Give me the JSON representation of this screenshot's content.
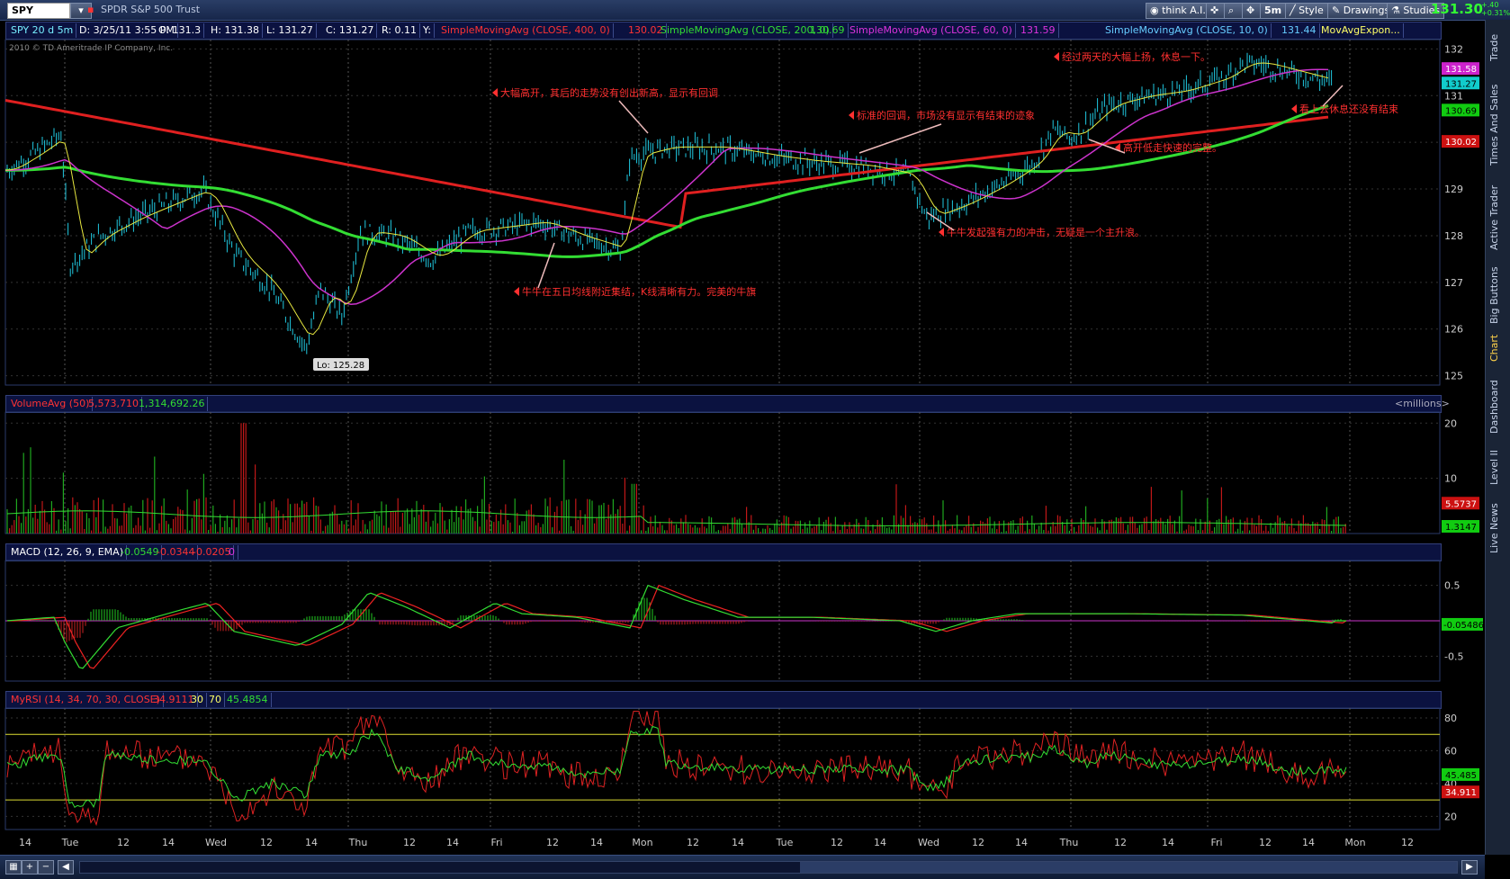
{
  "toolbar": {
    "symbol": "SPY",
    "symbol_desc": "SPDR S&P 500 Trust",
    "think_ai": "think A.I.",
    "interval": "5m",
    "style": "Style",
    "drawings": "Drawings",
    "studies": "Studies",
    "last_price": "131.30",
    "change_up": "+.40",
    "change_pct": "+0.31%"
  },
  "side_tabs": [
    "Trade",
    "Times And Sales",
    "Active Trader",
    "Big Buttons",
    "Chart",
    "Dashboard",
    "Level II",
    "Live News"
  ],
  "price_pane": {
    "header": [
      "SPY 20 d 5m",
      "D: 3/25/11 3:55 PM",
      "O: 131.3",
      "H: 131.38",
      "L: 131.27",
      "C: 131.27",
      "R: 0.11",
      "Y:",
      "SimpleMovingAvg (CLOSE, 400, 0)",
      "130.02",
      "SimpleMovingAvg (CLOSE, 200, 0)",
      "130.69",
      "SimpleMovingAvg (CLOSE, 60, 0)",
      "131.59"
    ],
    "header_right": [
      "SimpleMovingAvg (CLOSE, 10, 0)",
      "131.44",
      "MovAvgExpon..."
    ],
    "copyright": "2010 © TD Ameritrade IP Company, Inc.",
    "y_ticks": [
      "132",
      "131",
      "130",
      "129",
      "128",
      "127",
      "126",
      "125"
    ],
    "price_labels": [
      "131.58",
      "131.27",
      "130.69",
      "130.02"
    ],
    "low_label": "Lo: 125.28",
    "annotations": [
      "大幅高开，其后的走势没有创出新高，显示有回调",
      "标准的回调，市场没有显示有结束的迹象",
      "牛牛在五日均线附近集结，K线清晰有力。完美的牛旗",
      "牛牛发起强有力的冲击，无疑是一个主升浪。",
      "经过两天的大幅上扬，休息一下。",
      "高开低走快速的完整。",
      "看上去休息还没有结束"
    ]
  },
  "volume_pane": {
    "header": [
      "VolumeAvg (50)",
      "5,573,710",
      "1,314,692.26"
    ],
    "unit": "<millions>",
    "y_ticks": [
      "20",
      "10"
    ],
    "labels": [
      "5.5737",
      "1.3147"
    ]
  },
  "macd_pane": {
    "header": [
      "MACD (12, 26, 9, EMA)",
      "-0.0549",
      "-0.0344",
      "-0.0205",
      "0"
    ],
    "y_ticks": [
      "0.5",
      "-0.5"
    ],
    "label": "-0.05486"
  },
  "rsi_pane": {
    "header": [
      "MyRSI (14, 34, 70, 30, CLOSE)",
      "34.9111",
      "30",
      "70",
      "45.4854"
    ],
    "y_ticks": [
      "80",
      "60",
      "40",
      "20"
    ],
    "labels": [
      "45.485",
      "34.911"
    ]
  },
  "x_axis": [
    "14",
    "Tue",
    "12",
    "14",
    "Wed",
    "12",
    "14",
    "Thu",
    "12",
    "14",
    "Fri",
    "12",
    "14",
    "Mon",
    "12",
    "14",
    "Tue",
    "12",
    "14",
    "Wed",
    "12",
    "14",
    "Thu",
    "12",
    "14",
    "Fri",
    "12",
    "14",
    "Mon",
    "12"
  ],
  "colors": {
    "sma400": "#e02020",
    "sma200": "#33dd33",
    "sma60": "#cc33cc",
    "sma10": "#e8e840",
    "candle": "#20c8e0",
    "annotation": "#ff3030"
  }
}
